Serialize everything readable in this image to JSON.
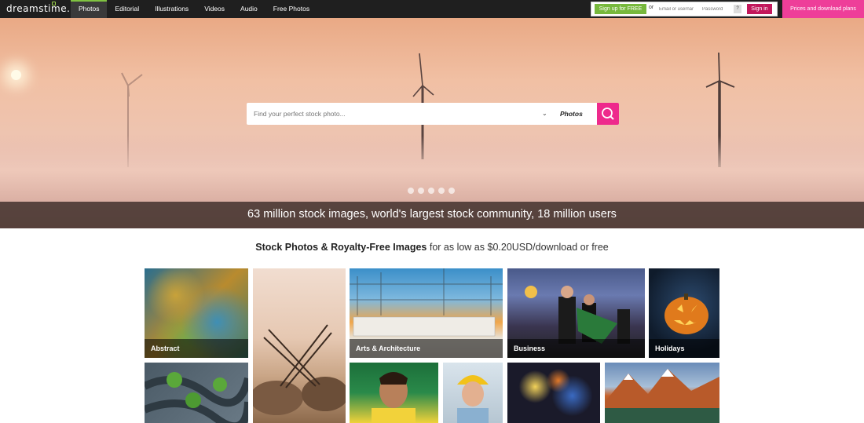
{
  "brand": {
    "logo": "dreamstime."
  },
  "nav": {
    "items": [
      "Photos",
      "Editorial",
      "Illustrations",
      "Videos",
      "Audio",
      "Free Photos"
    ],
    "active": "Photos"
  },
  "login": {
    "signup_label": "Sign up for FREE",
    "or": "or",
    "email_placeholder": "Email or usernar",
    "password_placeholder": "Password",
    "help": "?",
    "signin_label": "Sign in"
  },
  "prices_label": "Prices and download plans",
  "search": {
    "placeholder": "Find your perfect stock photo...",
    "category": "Photos"
  },
  "hero_banner": "63 million stock images, world's largest stock community, 18 million users",
  "tagline": {
    "bold": "Stock Photos & Royalty-Free Images",
    "rest": " for as low as $0.20USD/download or free"
  },
  "categories": [
    "Abstract",
    "Arts & Architecture",
    "Business",
    "Holidays"
  ],
  "colors": {
    "accent_pink": "#ee3e99",
    "signup_green": "#77b83c",
    "signin_red": "#c2185b"
  }
}
